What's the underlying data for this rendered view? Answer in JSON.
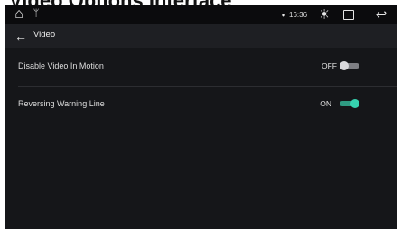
{
  "caption": "Video Options Interface",
  "status_bar": {
    "home_icon": "home-icon",
    "usb_icon": "usb-icon",
    "location_icon": "location-icon",
    "time": "16:36",
    "brightness_icon": "brightness-icon",
    "window_icon": "window-icon",
    "back_icon": "return-icon"
  },
  "header": {
    "title": "Video",
    "back_icon": "back-arrow-icon"
  },
  "settings": [
    {
      "label": "Disable Video In Motion",
      "value": "OFF",
      "enabled": false
    },
    {
      "label": "Reversing Warning Line",
      "value": "ON",
      "enabled": true
    }
  ],
  "colors": {
    "background": "#151619",
    "header": "#1e1f23",
    "accent": "#36d3b0",
    "toggle_off": "#7e7f84"
  }
}
